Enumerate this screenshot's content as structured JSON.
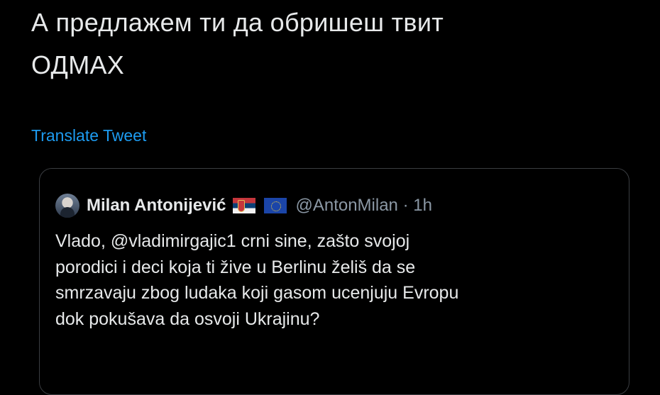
{
  "tweet": {
    "line1": "А предлажем ти да обришеш твит",
    "line2": "ОДМАХ",
    "translate_label": "Translate Tweet"
  },
  "quoted_tweet": {
    "author_name": "Milan Antonijević",
    "handle_time": "@AntonMilan · 1h",
    "flags": [
      "serbia-flag",
      "eu-flag"
    ],
    "body_lines": [
      "Vlado, @vladimirgajic1 crni sine, zašto svojoj",
      "porodici i deci koja ti žive u Berlinu želiš da se",
      "smrzavaju zbog ludaka koji gasom ucenjuju Evropu",
      "dok pokušava da osvoji Ukrajinu?"
    ]
  },
  "colors": {
    "background": "#000000",
    "text": "#e7e9ea",
    "link": "#1d9bf0",
    "muted": "#8b98a5",
    "border": "#3a3d41"
  }
}
